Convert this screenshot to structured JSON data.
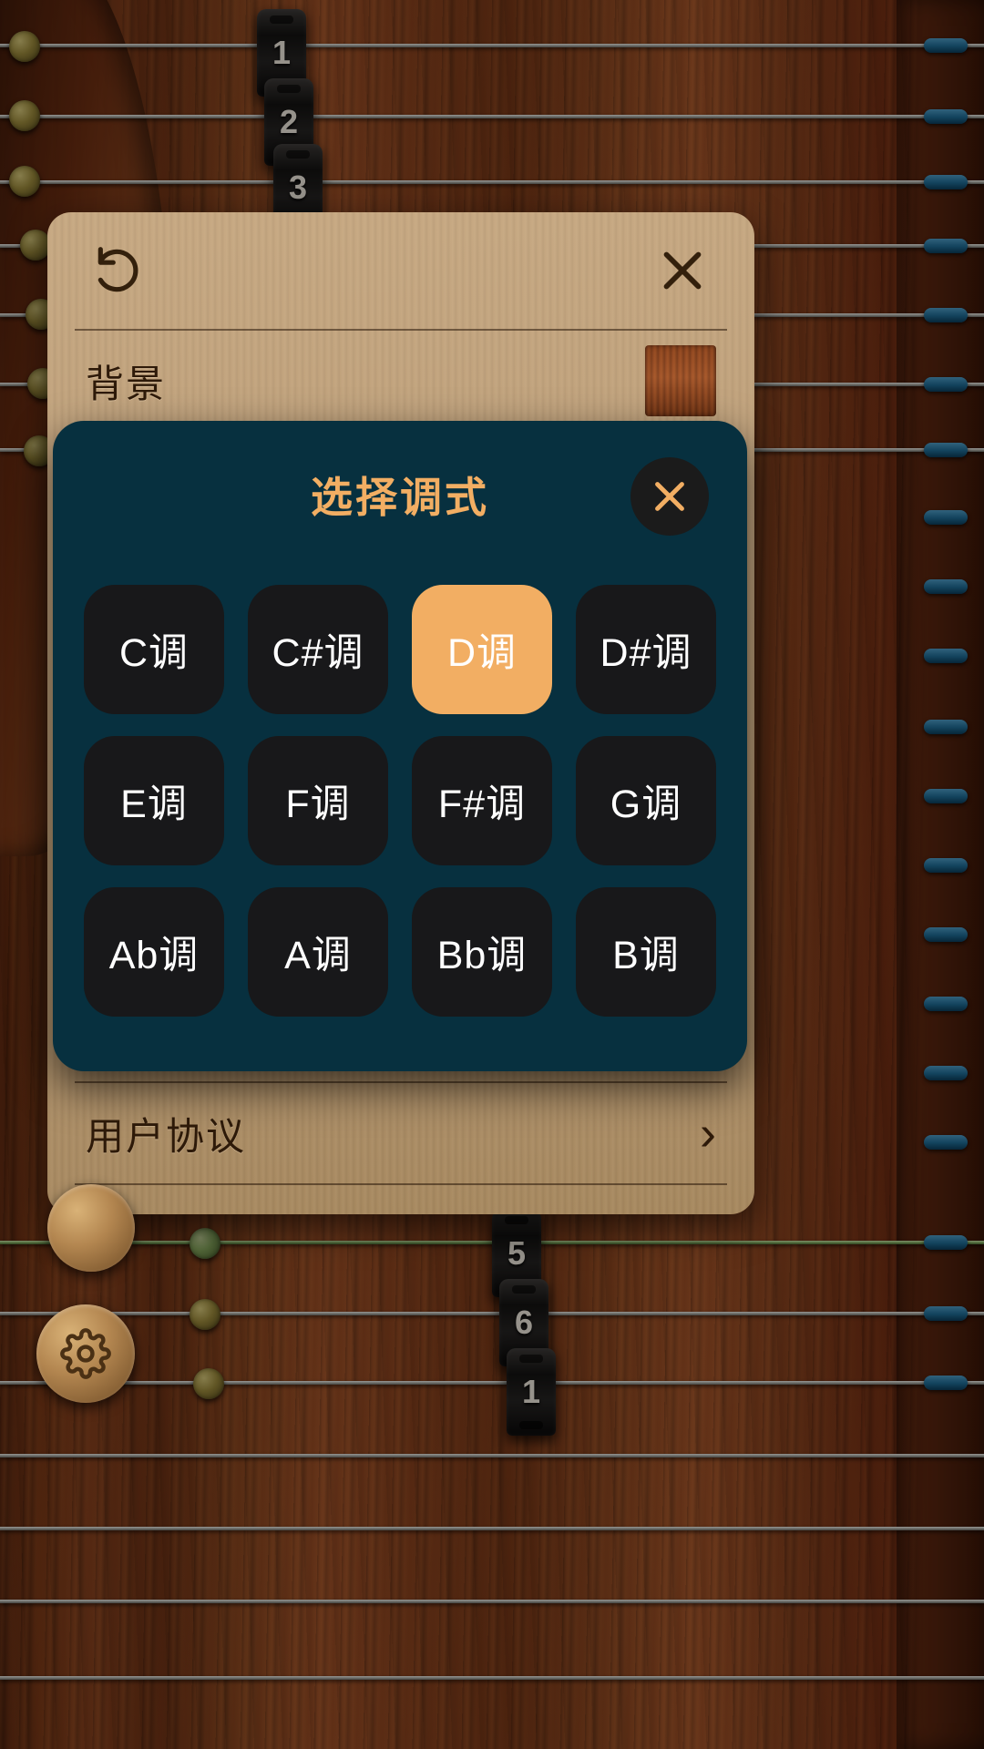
{
  "app": {
    "name": "guzheng-simulator",
    "instrument_numbers": [
      "1",
      "2",
      "3",
      "5",
      "6",
      "1"
    ]
  },
  "settings_panel": {
    "reset_icon": "restore-rotate-icon",
    "close_icon": "close-icon",
    "rows": [
      {
        "label": "背景",
        "control": "color-swatch",
        "swatch_color": "#8a431e"
      },
      {
        "label": "用户协议",
        "control": "chevron-right",
        "chevron": "›"
      }
    ]
  },
  "key_dialog": {
    "title": "选择调式",
    "close_icon": "close-icon",
    "close_glyph": "✕",
    "title_color": "#F2AE63",
    "background_color": "#07303F",
    "button_color": "#18181A",
    "selected_color": "#F2AE63",
    "selected_key": "D调",
    "keys": [
      {
        "label": "C调",
        "selected": false
      },
      {
        "label": "C#调",
        "selected": false
      },
      {
        "label": "D调",
        "selected": true
      },
      {
        "label": "D#调",
        "selected": false
      },
      {
        "label": "E调",
        "selected": false
      },
      {
        "label": "F调",
        "selected": false
      },
      {
        "label": "F#调",
        "selected": false
      },
      {
        "label": "G调",
        "selected": false
      },
      {
        "label": "Ab调",
        "selected": false
      },
      {
        "label": "A调",
        "selected": false
      },
      {
        "label": "Bb调",
        "selected": false
      },
      {
        "label": "B调",
        "selected": false
      }
    ]
  },
  "floating_buttons": {
    "settings_icon": "gear-icon"
  }
}
